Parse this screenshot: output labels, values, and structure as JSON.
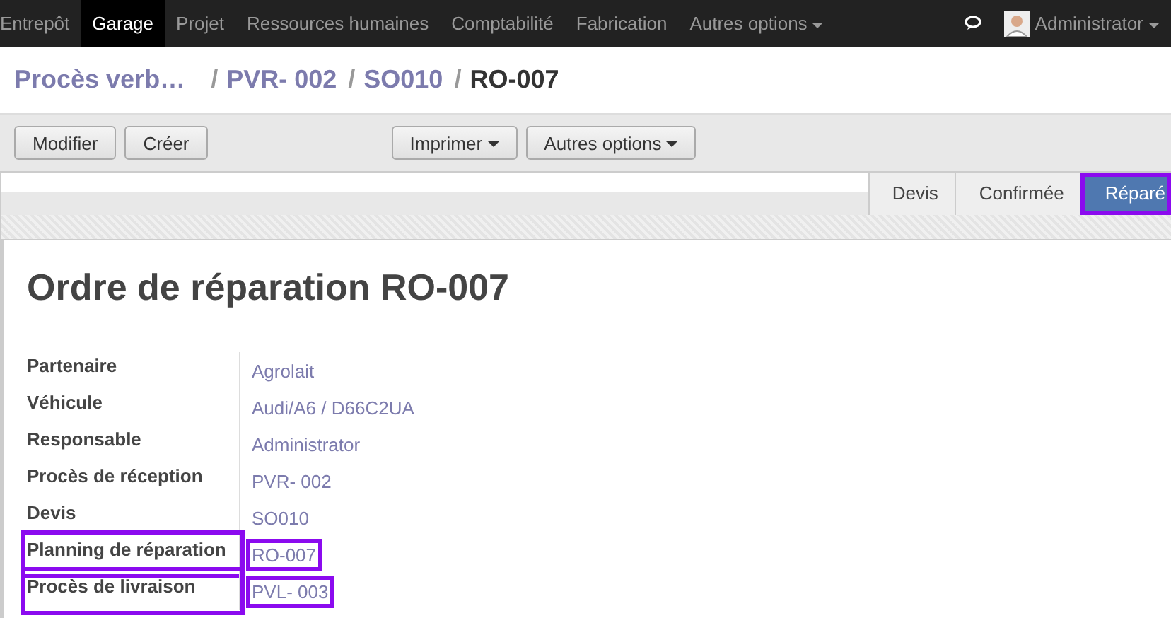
{
  "top_menu": {
    "items": [
      {
        "label": "Entrepôt",
        "selected": false
      },
      {
        "label": "Garage",
        "selected": true
      },
      {
        "label": "Projet",
        "selected": false
      },
      {
        "label": "Ressources humaines",
        "selected": false
      },
      {
        "label": "Comptabilité",
        "selected": false
      },
      {
        "label": "Fabrication",
        "selected": false
      }
    ],
    "more": "Autres options",
    "user": "Administrator"
  },
  "breadcrumb": [
    "Procès verb…",
    "PVR- 002",
    "SO010",
    "RO-007"
  ],
  "breadcrumb_separator": "/",
  "toolbar": {
    "left_buttons": [
      "Modifier",
      "Créer"
    ],
    "dropdowns": [
      "Imprimer",
      "Autres options"
    ]
  },
  "status_steps": [
    {
      "label": "Devis",
      "selected": false,
      "highlighted": false
    },
    {
      "label": "Confirmée",
      "selected": false,
      "highlighted": false
    },
    {
      "label": "Réparé",
      "selected": true,
      "highlighted": true
    }
  ],
  "form": {
    "title_prefix": "Ordre de réparation",
    "title_ref": "RO-007",
    "fields": [
      {
        "label": "Partenaire",
        "value": "Agrolait",
        "highlighted": false
      },
      {
        "label": "Véhicule",
        "value": "Audi/A6 / D66C2UA",
        "highlighted": false
      },
      {
        "label": "Responsable",
        "value": "Administrator",
        "highlighted": false
      },
      {
        "label": "Procès de réception",
        "value": "PVR- 002",
        "highlighted": false
      },
      {
        "label": "Devis",
        "value": "SO010",
        "highlighted": false
      },
      {
        "label": "Planning de réparation",
        "value": "RO-007",
        "highlighted": true
      },
      {
        "label": "Procès de livraison",
        "value": "PVL- 003",
        "highlighted": true
      }
    ]
  }
}
